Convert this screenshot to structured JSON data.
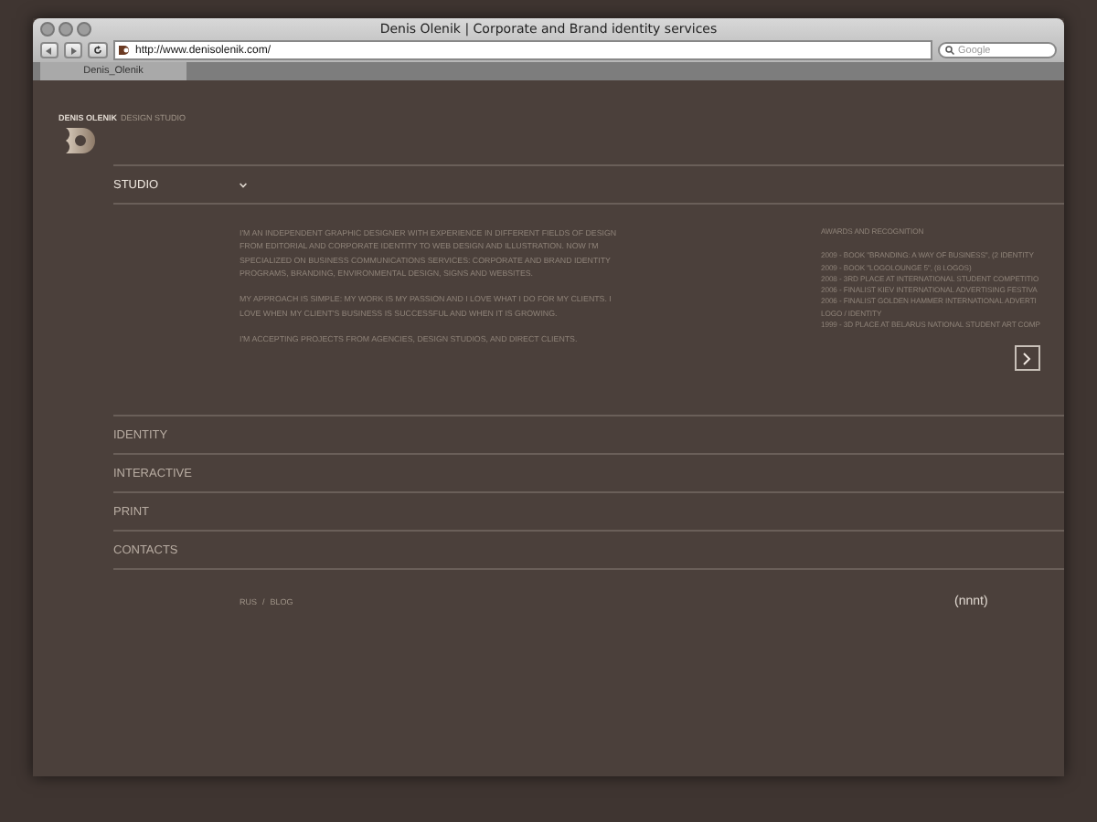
{
  "browser": {
    "title": "Denis Olenik | Corporate and Brand identity services",
    "url": "http://www.denisolenik.com/",
    "search": {
      "placeholder": "Google"
    },
    "tabs": [
      {
        "label": "Denis_Olenik",
        "selected": true
      }
    ]
  },
  "brand": {
    "name": "DENIS OLENIK",
    "subtitle": "DESIGN STUDIO"
  },
  "nav": [
    {
      "label": "STUDIO",
      "expanded": true
    },
    {
      "label": "IDENTITY",
      "expanded": false
    },
    {
      "label": "INTERACTIVE",
      "expanded": false
    },
    {
      "label": "PRINT",
      "expanded": false
    },
    {
      "label": "CONTACTS",
      "expanded": false
    }
  ],
  "studio": {
    "paragraphs": [
      "I'M AN INDEPENDENT GRAPHIC DESIGNER WITH EXPERIENCE IN DIFFERENT FIELDS OF DESIGN FROM EDITORIAL AND CORPORATE IDENTITY TO WEB DESIGN AND ILLUSTRATION. NOW I'M SPECIALIZED ON BUSINESS COMMUNICATIONS SERVICES: CORPORATE AND BRAND IDENTITY PROGRAMS, BRANDING, ENVIRONMENTAL DESIGN, SIGNS AND WEBSITES.",
      "MY APPROACH IS SIMPLE: MY WORK IS MY PASSION AND I LOVE WHAT I DO FOR MY CLIENTS. I LOVE WHEN MY CLIENT'S BUSINESS IS SUCCESSFUL AND WHEN IT IS GROWING.",
      "I'M ACCEPTING PROJECTS FROM AGENCIES, DESIGN STUDIOS, AND DIRECT CLIENTS."
    ],
    "awards_title": "AWARDS AND RECOGNITION",
    "awards": [
      "2009 - BOOK \"BRANDING: A WAY OF BUSINESS\", (2 IDENTITY",
      "2009 - BOOK \"LOGOLOUNGE 5\", (8 LOGOS)",
      "2008 - 3RD PLACE AT INTERNATIONAL STUDENT COMPETITIO",
      "2006 - FINALIST KIEV INTERNATIONAL ADVERTISING FESTIVA",
      "2006 - FINALIST GOLDEN HAMMER INTERNATIONAL ADVERTI",
      "LOGO / IDENTITY",
      "1999 - 3D PLACE AT BELARUS NATIONAL STUDENT ART COMP"
    ]
  },
  "footer": {
    "links": [
      "RUS",
      "BLOG"
    ],
    "separator": "/",
    "mark": "(nnnt)"
  }
}
